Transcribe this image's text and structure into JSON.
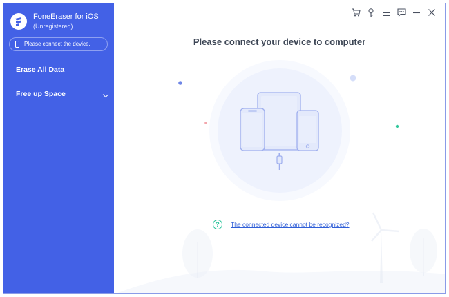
{
  "app": {
    "name": "FoneEraser for iOS",
    "status": "(Unregistered)"
  },
  "sidebar": {
    "device_status": "Please connect the device.",
    "items": [
      {
        "label": "Erase All Data"
      },
      {
        "label": "Free up Space",
        "has_submenu": true
      }
    ]
  },
  "titlebar": {
    "icons": [
      "cart-icon",
      "key-icon",
      "menu-icon",
      "feedback-icon",
      "minimize-icon",
      "close-icon"
    ]
  },
  "main": {
    "title": "Please connect your device to computer",
    "help_link": "The connected device cannot be recognized?"
  },
  "colors": {
    "sidebar": "#4361e6",
    "accent": "#27c39a",
    "link": "#2f5ed7",
    "title": "#3d4655"
  }
}
